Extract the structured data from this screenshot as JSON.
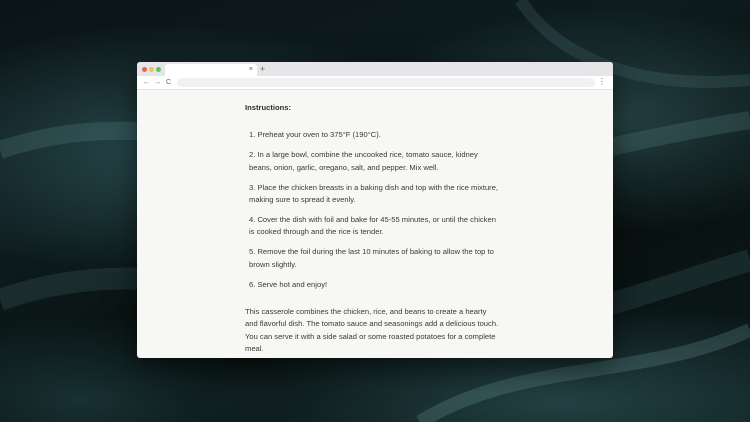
{
  "browser": {
    "tab_close": "×",
    "new_tab": "+",
    "back": "←",
    "forward": "→",
    "reload": "C",
    "menu": "⋮"
  },
  "page": {
    "heading": "Instructions:",
    "steps": [
      "1. Preheat your oven to 375°F (190°C).",
      "2. In a large bowl, combine the uncooked rice, tomato sauce, kidney beans, onion, garlic, oregano, salt, and pepper. Mix well.",
      "3. Place the chicken breasts in a baking dish and top with the rice mixture, making sure to spread it evenly.",
      "4. Cover the dish with foil and bake for 45-55 minutes, or until the chicken is cooked through and the rice is tender.",
      "5. Remove the foil during the last 10 minutes of baking to allow the top to brown slightly.",
      "6. Serve hot and enjoy!"
    ],
    "paragraph": "This casserole combines the chicken, rice, and beans to create a hearty and flavorful dish. The tomato sauce and seasonings add a delicious touch. You can serve it with a side salad or some roasted potatoes for a complete meal."
  }
}
